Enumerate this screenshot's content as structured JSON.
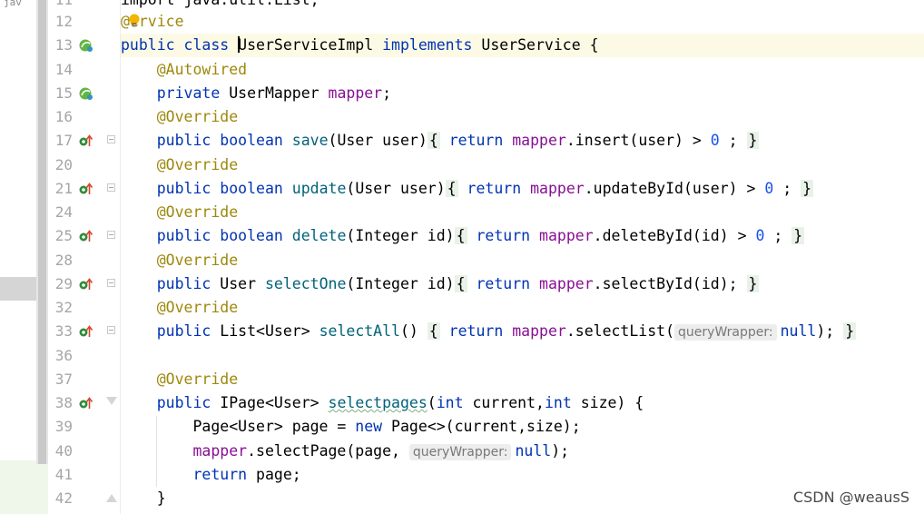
{
  "left_panel": {
    "stub_text": "jav"
  },
  "gutter": {
    "rows": [
      {
        "ln": "11",
        "icon": ""
      },
      {
        "ln": "12",
        "icon": ""
      },
      {
        "ln": "13",
        "icon": "bean-icon"
      },
      {
        "ln": "14",
        "icon": ""
      },
      {
        "ln": "15",
        "icon": "bean-icon"
      },
      {
        "ln": "16",
        "icon": ""
      },
      {
        "ln": "17",
        "icon": "implementing-method-icon"
      },
      {
        "ln": "20",
        "icon": ""
      },
      {
        "ln": "21",
        "icon": "implementing-method-icon"
      },
      {
        "ln": "24",
        "icon": ""
      },
      {
        "ln": "25",
        "icon": "implementing-method-icon"
      },
      {
        "ln": "28",
        "icon": ""
      },
      {
        "ln": "29",
        "icon": "implementing-method-icon"
      },
      {
        "ln": "32",
        "icon": ""
      },
      {
        "ln": "33",
        "icon": "implementing-method-icon"
      },
      {
        "ln": "36",
        "icon": ""
      },
      {
        "ln": "37",
        "icon": ""
      },
      {
        "ln": "38",
        "icon": "implementing-method-icon"
      },
      {
        "ln": "39",
        "icon": ""
      },
      {
        "ln": "40",
        "icon": ""
      },
      {
        "ln": "41",
        "icon": ""
      },
      {
        "ln": "42",
        "icon": ""
      }
    ]
  },
  "code": {
    "l11": {
      "text": "import java.util.List;"
    },
    "l12": {
      "at": "@",
      "name": "ervice"
    },
    "l13": {
      "public": "public",
      "class": "class",
      "classname": "UserServiceImpl",
      "implements": "implements",
      "iface": "UserService",
      "brace": "{"
    },
    "l14": {
      "ann": "@Autowired"
    },
    "l15": {
      "kw": "private",
      "type": "UserMapper",
      "field": "mapper",
      "semi": ";"
    },
    "l16": {
      "ann": "@Override"
    },
    "l17": {
      "pub": "public",
      "ty": "boolean",
      "name": "save",
      "params": "(User user)",
      "open": "{",
      "ret": "return",
      "field": "mapper",
      "call": ".insert(user) > ",
      "num": "0",
      "semi": " ;",
      "close": "}"
    },
    "l20": {
      "ann": "@Override"
    },
    "l21": {
      "pub": "public",
      "ty": "boolean",
      "name": "update",
      "params": "(User user)",
      "open": "{",
      "ret": "return",
      "field": "mapper",
      "call": ".updateById(user) > ",
      "num": "0",
      "semi": " ;",
      "close": "}"
    },
    "l24": {
      "ann": "@Override"
    },
    "l25": {
      "pub": "public",
      "ty": "boolean",
      "name": "delete",
      "params": "(Integer id)",
      "open": "{",
      "ret": "return",
      "field": "mapper",
      "call": ".deleteById(id) > ",
      "num": "0",
      "semi": " ;",
      "close": "}"
    },
    "l28": {
      "ann": "@Override"
    },
    "l29": {
      "pub": "public",
      "ty": "User",
      "name": "selectOne",
      "params": "(Integer id)",
      "open": "{",
      "ret": "return",
      "field": "mapper",
      "call": ".selectById(id);",
      "close": "}"
    },
    "l32": {
      "ann": "@Override"
    },
    "l33": {
      "pub": "public",
      "ty": "List<User>",
      "name": "selectAll",
      "params": "()",
      "open": "{",
      "ret": "return",
      "field": "mapper",
      "call": ".selectList(",
      "hint": "queryWrapper:",
      "nullkw": "null",
      "tail": ");",
      "close": "}"
    },
    "l37": {
      "ann": "@Override"
    },
    "l38": {
      "pub": "public",
      "ty": "IPage<User>",
      "name": "selectpages",
      "p1": "(",
      "int1": "int",
      "p2": " current,",
      "int2": "int",
      "p3": " size) {"
    },
    "l39": {
      "a": "Page<User> page = ",
      "new": "new",
      "b": " Page<>(current,size);"
    },
    "l40": {
      "field": "mapper",
      "a": ".selectPage(page, ",
      "hint": "queryWrapper:",
      "nullkw": "null",
      "tail": ");"
    },
    "l41": {
      "ret": "return",
      "a": " page;"
    },
    "l42": {
      "close": "}"
    }
  },
  "watermark": "CSDN @weausS"
}
